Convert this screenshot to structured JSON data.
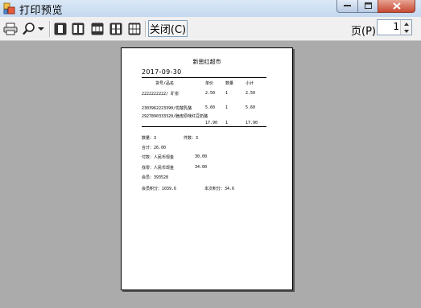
{
  "window": {
    "title": "打印预览"
  },
  "toolbar": {
    "close_label": "关闭(C)",
    "page_label": "页(P)",
    "page_value": "1"
  },
  "receipt": {
    "store_name": "新思红超市",
    "date": "2017-09-30",
    "headers": {
      "item": "货号/品名",
      "price": "单价",
      "qty": "数量",
      "subtotal": "小计"
    },
    "items": [
      {
        "name": "2222222222/ 矿泉",
        "price": "2.50",
        "qty": "1",
        "subtotal": "2.50"
      },
      {
        "name": "2303962223390/优酸乳酪",
        "price": "5.60",
        "qty": "1",
        "subtotal": "5.60"
      },
      {
        "name": "2927890333320/脆皮原味红豆奶酪",
        "price": "17.90",
        "qty": "1",
        "subtotal": "17.90"
      }
    ],
    "summary": {
      "qty_label": "数量：3",
      "count_label": "件数：3",
      "total_label": "合计：26.00",
      "paid_label": "付款：人民币现金",
      "paid_value": "30.00",
      "change_label": "找零：人民币现金",
      "change_value": "34.00",
      "member_label": "会员：393528",
      "points_label": "会员积分：1039.6",
      "this_points_label": "本次积分：34.6"
    }
  }
}
